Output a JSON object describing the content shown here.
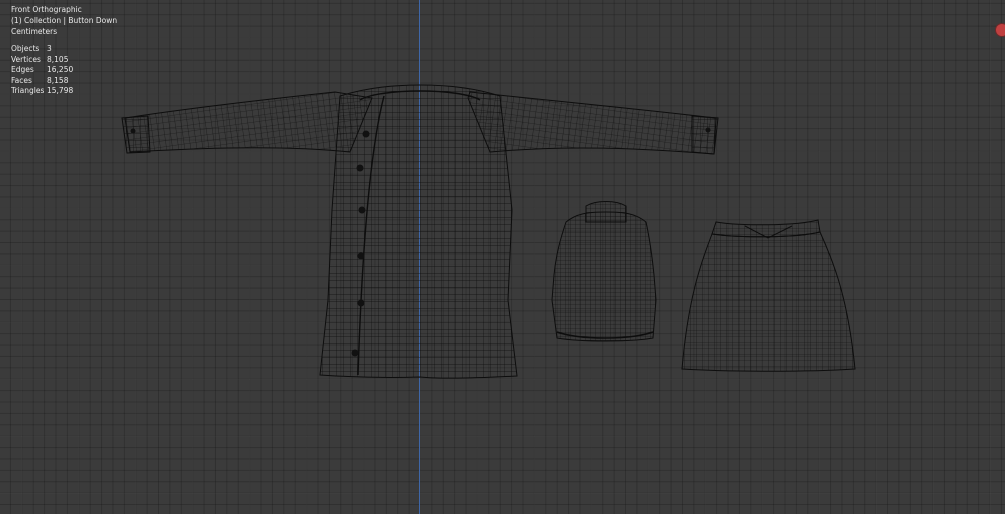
{
  "viewport": {
    "view_name": "Front Orthographic",
    "collection_line": "(1) Collection | Button Down",
    "units": "Centimeters",
    "stats": [
      {
        "label": "Objects",
        "value": "3"
      },
      {
        "label": "Vertices",
        "value": "8,105"
      },
      {
        "label": "Edges",
        "value": "16,250"
      },
      {
        "label": "Faces",
        "value": "8,158"
      },
      {
        "label": "Triangles",
        "value": "15,798"
      }
    ],
    "colors": {
      "background": "#3b3b3b",
      "wire": "#0d0d0d",
      "axis_z": "#3f67a8",
      "record": "#c04040"
    },
    "icons": [
      "record-icon"
    ]
  }
}
